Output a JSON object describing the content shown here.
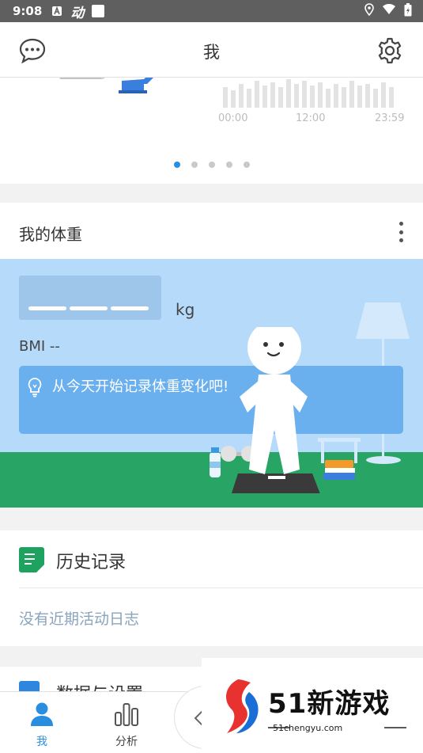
{
  "status_bar": {
    "time": "9:08",
    "app_icon_text": "动"
  },
  "header": {
    "title": "我"
  },
  "carousel": {
    "time_ticks": [
      "00:00",
      "12:00",
      "23:59"
    ],
    "page_count": 5,
    "active_page": 1
  },
  "weight_card": {
    "title": "我的体重",
    "weight_unit": "kg",
    "bmi_text": "BMI --",
    "tip": "从今天开始记录体重变化吧!"
  },
  "history": {
    "title": "历史记录",
    "empty_text": "没有近期活动日志"
  },
  "data_settings": {
    "title": "数据与设置"
  },
  "bottom_nav": {
    "items": [
      {
        "label": "我",
        "icon": "person-icon",
        "active": true
      },
      {
        "label": "分析",
        "icon": "bar-chart-icon",
        "active": false
      }
    ]
  },
  "watermark": {
    "main": "51新游戏",
    "sub": "51chengyu.com"
  },
  "colors": {
    "accent": "#2a8ee0",
    "sky": "#b6dbfa",
    "ground": "#28a565",
    "tip_bg": "#6aafee",
    "history_icon": "#1ea260",
    "watermark_red": "#e8322f",
    "watermark_blue": "#1a6fd6"
  }
}
